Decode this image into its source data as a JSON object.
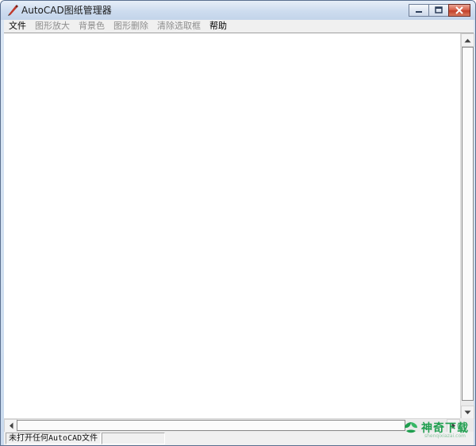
{
  "window": {
    "title": "AutoCAD图纸管理器"
  },
  "menu": [
    {
      "label": "文件",
      "enabled": true
    },
    {
      "label": "图形放大",
      "enabled": false
    },
    {
      "label": "背景色",
      "enabled": false
    },
    {
      "label": "图形删除",
      "enabled": false
    },
    {
      "label": "清除选取框",
      "enabled": false
    },
    {
      "label": "帮助",
      "enabled": true
    }
  ],
  "status": {
    "message": "未打开任何AutoCAD文件",
    "pane2": ""
  },
  "watermark": {
    "brand": "神奇下载",
    "site": "shenqixiazai.com"
  },
  "colors": {
    "close_button": "#c8452f",
    "watermark": "#1e9e4e",
    "menu_disabled": "#8d8d8d"
  },
  "icons": {
    "app": "pen-icon",
    "minimize": "minimize-icon",
    "maximize": "maximize-icon",
    "close": "close-icon",
    "scroll_up": "arrow-up-icon",
    "scroll_down": "arrow-down-icon",
    "scroll_left": "arrow-left-icon",
    "scroll_right": "arrow-right-icon"
  }
}
